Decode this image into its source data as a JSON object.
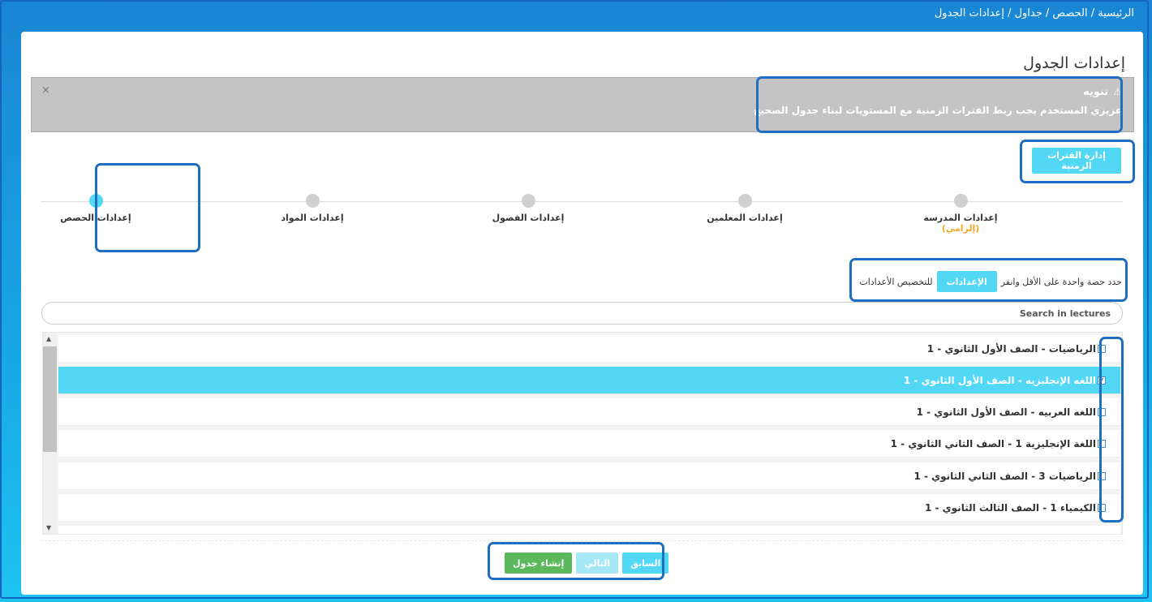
{
  "breadcrumb": "الرئيسية / الحصص / جداول / إعدادات الجدول",
  "page_title": "إعدادات الجدول",
  "alert": {
    "close": "×",
    "icon": "warning-icon",
    "heading": "تنويه",
    "text": "عزيزي المستخدم يجب ربط الفترات الزمنية مع المستويات لبناء جدول الصحيح"
  },
  "periods_button": "إدارة الفترات الزمنية",
  "steps": [
    {
      "label": "إعدادات المدرسة",
      "note": "(إلزامي)",
      "active": false
    },
    {
      "label": "إعدادات المعلمين",
      "note": "",
      "active": false
    },
    {
      "label": "إعدادات الفصول",
      "note": "",
      "active": false
    },
    {
      "label": "إعدادات المواد",
      "note": "",
      "active": false
    },
    {
      "label": "إعدادات الحصص",
      "note": "",
      "active": true
    }
  ],
  "instruction": {
    "before": "حدد حصة واحدة على الأقل وانقر",
    "button": "الإعدادات",
    "after": "للتخصيص الأعدادات"
  },
  "search": {
    "placeholder": "Search in lectures",
    "value": ""
  },
  "lectures": [
    {
      "label": "الرياضيات - الصف الأول الثانوي - 1",
      "checked": false
    },
    {
      "label": "اللغه الإنجليزيه - الصف الأول الثانوي - 1",
      "checked": true
    },
    {
      "label": "اللغه العربيه - الصف الأول الثانوي - 1",
      "checked": false
    },
    {
      "label": "اللغة الإنجليزية 1 - الصف الثاني الثانوي - 1",
      "checked": false
    },
    {
      "label": "الرياضيات 3 - الصف الثاني الثانوي - 1",
      "checked": false
    },
    {
      "label": "الكيمياء 1 - الصف الثالث الثانوي - 1",
      "checked": false
    }
  ],
  "footer": {
    "prev": "السابق",
    "next": "التالي",
    "create": "إنشاء جدول"
  },
  "colors": {
    "accent": "#52d8f5",
    "highlight": "#1f6fc0",
    "success": "#5cb85c",
    "required": "#f5a623"
  }
}
